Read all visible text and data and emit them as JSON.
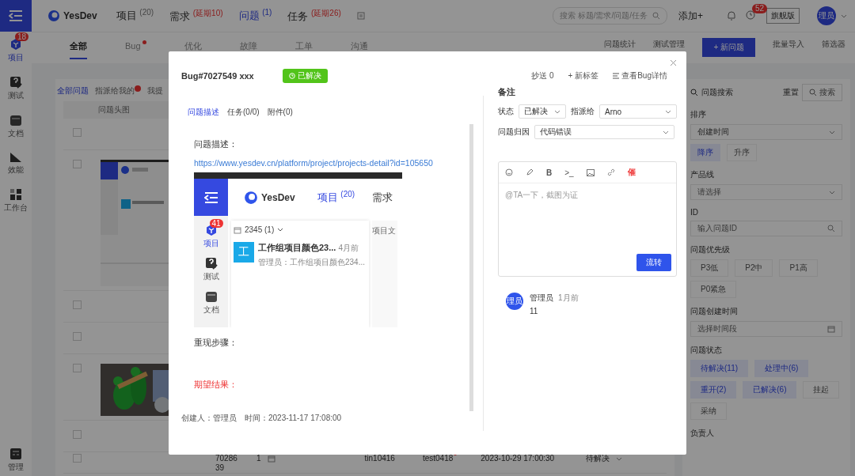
{
  "top_bar": {
    "logo": "YesDev",
    "nav": [
      {
        "label": "项目",
        "count": "(20)",
        "kind": "count",
        "selected": false
      },
      {
        "label": "需求",
        "count": "(延期10)",
        "kind": "overdue",
        "selected": false
      },
      {
        "label": "问题",
        "count": "(1)",
        "kind": "count",
        "selected": true
      },
      {
        "label": "任务",
        "count": "(延期26)",
        "kind": "overdue",
        "selected": false
      }
    ],
    "search_placeholder": "搜索 标题/需求/问题/任务",
    "add": "添加+",
    "alarm_badge": "52",
    "edition": "旗舰版",
    "avatar": "理员"
  },
  "side_nav": [
    {
      "label": "项目",
      "badge": "18",
      "selected": true
    },
    {
      "label": "测试",
      "selected": false
    },
    {
      "label": "文档",
      "selected": false
    },
    {
      "label": "效能",
      "selected": false
    },
    {
      "label": "工作台",
      "selected": false
    },
    {
      "label": "管理",
      "selected": false
    }
  ],
  "category_tabs": [
    {
      "label": "全部",
      "dot": false,
      "selected": true
    },
    {
      "label": "Bug",
      "dot": true,
      "selected": false
    },
    {
      "label": "优化",
      "dot": false,
      "selected": false
    },
    {
      "label": "故障",
      "dot": false,
      "selected": false
    },
    {
      "label": "工单",
      "dot": false,
      "selected": false
    },
    {
      "label": "沟通",
      "dot": false,
      "selected": false
    }
  ],
  "actions": [
    {
      "label": "问题统计",
      "kind": "link"
    },
    {
      "label": "测试管理",
      "kind": "link"
    },
    {
      "label": "+ 新问题",
      "kind": "primary"
    },
    {
      "label": "批量导入",
      "kind": "link"
    },
    {
      "label": "筛选器",
      "kind": "link"
    }
  ],
  "filters": [
    {
      "label": "全部问题",
      "dot": false,
      "selected": true
    },
    {
      "label": "指派给我的",
      "dot": true,
      "selected": false
    },
    {
      "label": "我提",
      "dot": false,
      "selected": false
    }
  ],
  "table": {
    "columns": [
      "问题头图"
    ],
    "rows": [
      {
        "kind": "blank",
        "checked": false
      },
      {
        "kind": "picture",
        "checked": false
      },
      {
        "kind": "blank",
        "checked": false
      },
      {
        "kind": "blank",
        "checked": false
      },
      {
        "kind": "picture",
        "checked": false
      },
      {
        "kind": "blank",
        "checked": false
      },
      {
        "kind": "data",
        "checked": false,
        "id": "7028639",
        "priority": "1",
        "creator": "tin10416",
        "assignee": "test0418",
        "time": "2023-10-29 17:00:30",
        "status": "待解决"
      }
    ]
  },
  "search_panel": {
    "title": "问题搜索",
    "reset": "重置",
    "search": "搜索",
    "sort": {
      "label": "排序",
      "value": "创建时间",
      "orders": [
        {
          "label": "降序",
          "selected": true
        },
        {
          "label": "升序",
          "selected": false
        }
      ]
    },
    "product_line": {
      "label": "产品线",
      "placeholder": "请选择"
    },
    "id": {
      "label": "ID",
      "placeholder": "输入问题ID"
    },
    "priority": {
      "label": "问题优先级",
      "options": [
        "P3低",
        "P2中",
        "P1高",
        "P0紧急"
      ]
    },
    "created": {
      "label": "问题创建时间",
      "placeholder": "选择时间段"
    },
    "status": {
      "label": "问题状态",
      "options": [
        {
          "label": "待解决(11)",
          "selected": true
        },
        {
          "label": "处理中(6)",
          "selected": true
        },
        {
          "label": "重开(2)",
          "selected": true
        },
        {
          "label": "已解决(6)",
          "selected": true
        },
        {
          "label": "挂起",
          "selected": false
        },
        {
          "label": "采纳",
          "selected": false
        }
      ]
    },
    "owner": {
      "label": "负责人"
    }
  },
  "modal": {
    "title": "Bug#7027549 xxx",
    "status": "已解决",
    "cc": "抄送 0",
    "new_tag": "+ 新标签",
    "view_detail": "查看Bug详情",
    "tabs": [
      {
        "label": "问题描述",
        "selected": true
      },
      {
        "label": "任务(0/0)",
        "selected": false
      },
      {
        "label": "附件(0)",
        "selected": false
      }
    ],
    "description_label": "问题描述：",
    "link": "https://www.yesdev.cn/platform/project/projects-detail?id=105650",
    "screenshot": {
      "logo": "YesDev",
      "nav": [
        {
          "label": "项目",
          "count": "(20)",
          "selected": true
        },
        {
          "label": "需求",
          "selected": false
        }
      ],
      "side": [
        {
          "label": "项目",
          "badge": "41",
          "selected": true
        },
        {
          "label": "测试",
          "selected": false
        },
        {
          "label": "文档",
          "selected": false
        }
      ],
      "project": "2345 (1)",
      "tab": "项目文",
      "card": {
        "initial": "工",
        "title": "工作组项目颜色23...",
        "time": "4月前",
        "meta": "管理员：工作组项目颜色234..."
      }
    },
    "steps_label": "重现步骤：",
    "expected_label": "期望结果：",
    "creator": "创建人：管理员",
    "time": "时间：2023-11-17 17:08:00"
  },
  "remarks": {
    "heading": "备注",
    "fields": [
      {
        "label": "状态",
        "value": "已解决"
      },
      {
        "label": "指派给",
        "value": "Arno"
      },
      {
        "label": "问题归因",
        "value": "代码错误"
      }
    ],
    "editor": {
      "bold": "B",
      "code": ">_",
      "urge": "催",
      "placeholder": "@TA一下，截图为证",
      "submit": "流转"
    },
    "comments": [
      {
        "avatar": "理员",
        "author": "管理员",
        "time": "1月前",
        "text": "11"
      }
    ]
  }
}
